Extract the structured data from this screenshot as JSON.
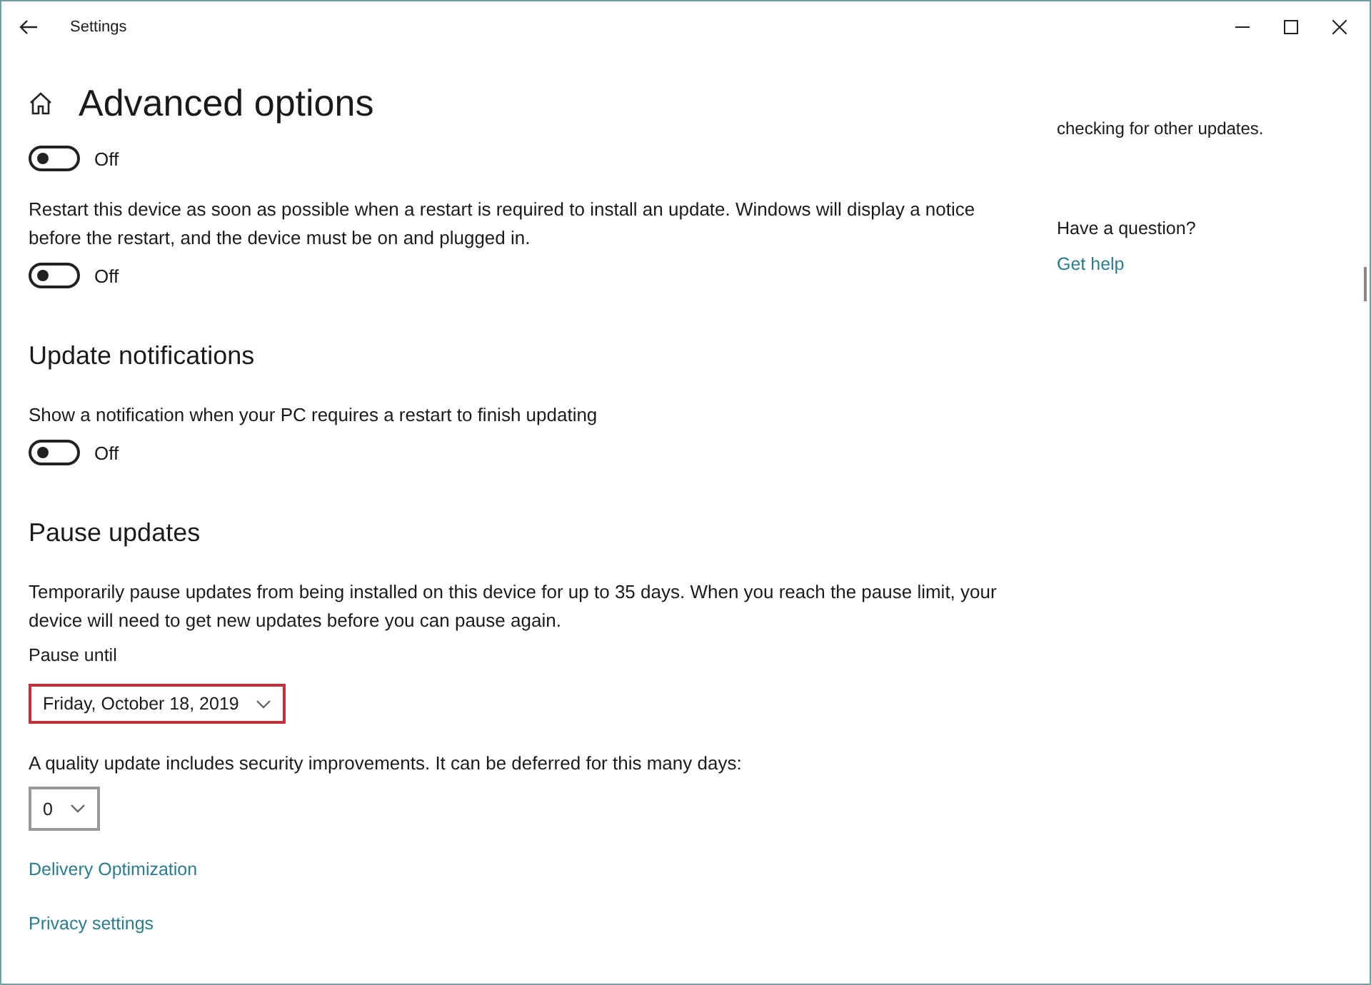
{
  "window": {
    "title": "Settings"
  },
  "page_title": "Advanced options",
  "blocks": [
    {
      "kind": "toggle",
      "on": false,
      "label": "Off"
    },
    {
      "kind": "text",
      "text": "Restart this device as soon as possible when a restart is required to install an update. Windows will display a notice before the restart, and the device must be on and plugged in."
    },
    {
      "kind": "toggle",
      "on": false,
      "label": "Off"
    },
    {
      "kind": "heading",
      "text": "Update notifications"
    },
    {
      "kind": "text",
      "text": "Show a notification when your PC requires a restart to finish updating"
    },
    {
      "kind": "toggle",
      "on": false,
      "label": "Off"
    },
    {
      "kind": "heading",
      "text": "Pause updates"
    },
    {
      "kind": "text",
      "text": "Temporarily pause updates from being installed on this device for up to 35 days. When you reach the pause limit, your device will need to get new updates before you can pause again."
    },
    {
      "kind": "label",
      "text": "Pause until"
    },
    {
      "kind": "dropdown",
      "value": "Friday, October 18, 2019",
      "highlighted": true
    },
    {
      "kind": "text",
      "text": "A quality update includes security improvements. It can be deferred for this many days:"
    },
    {
      "kind": "dropdown",
      "value": "0",
      "highlighted": false
    },
    {
      "kind": "link",
      "text": "Delivery Optimization"
    },
    {
      "kind": "link",
      "text": "Privacy settings"
    }
  ],
  "sidebar": {
    "note": "checking for other updates.",
    "question": "Have a question?",
    "link": "Get help"
  }
}
